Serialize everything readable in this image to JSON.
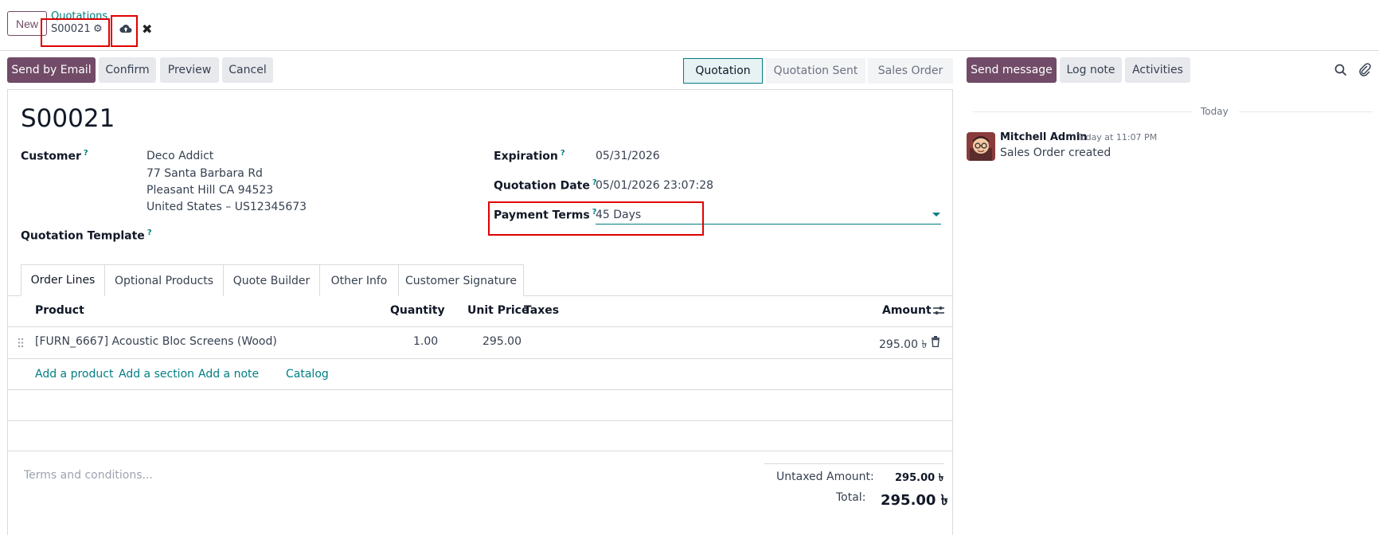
{
  "breadcrumb": {
    "parent": "Quotations",
    "record": "S00021"
  },
  "buttons": {
    "new": "New",
    "send_email": "Send by Email",
    "confirm": "Confirm",
    "preview": "Preview",
    "cancel": "Cancel"
  },
  "statusbar": [
    "Quotation",
    "Quotation Sent",
    "Sales Order"
  ],
  "chatter": {
    "send_message": "Send message",
    "log_note": "Log note",
    "activities": "Activities",
    "date_separator": "Today",
    "message": {
      "author": "Mitchell Admin",
      "time": "Today at 11:07 PM",
      "body": "Sales Order created"
    }
  },
  "form": {
    "title": "S00021",
    "customer_label": "Customer",
    "customer_name": "Deco Addict",
    "customer_addr1": "77 Santa Barbara Rd",
    "customer_addr2": "Pleasant Hill CA 94523",
    "customer_addr3": "United States – US12345673",
    "template_label": "Quotation Template",
    "expiration_label": "Expiration",
    "expiration_value": "05/31/2026",
    "qdate_label": "Quotation Date",
    "qdate_value": "05/01/2026 23:07:28",
    "payment_label": "Payment Terms",
    "payment_value": "45 Days",
    "help": "?"
  },
  "tabs": [
    "Order Lines",
    "Optional Products",
    "Quote Builder",
    "Other Info",
    "Customer Signature"
  ],
  "table": {
    "headers": {
      "product": "Product",
      "quantity": "Quantity",
      "unit_price": "Unit Price",
      "taxes": "Taxes",
      "amount": "Amount"
    },
    "rows": [
      {
        "product": "[FURN_6667] Acoustic Bloc Screens (Wood)",
        "quantity": "1.00",
        "unit_price": "295.00",
        "taxes": "",
        "amount": "295.00 ৳"
      }
    ],
    "add_product": "Add a product",
    "add_section": "Add a section",
    "add_note": "Add a note",
    "catalog": "Catalog"
  },
  "footer": {
    "terms_placeholder": "Terms and conditions...",
    "untaxed_label": "Untaxed Amount:",
    "untaxed_value": "295.00 ৳",
    "total_label": "Total:",
    "total_value": "295.00 ৳"
  },
  "colors": {
    "primary": "#714B67",
    "accent": "#017e84",
    "highlight": "#e00000"
  }
}
